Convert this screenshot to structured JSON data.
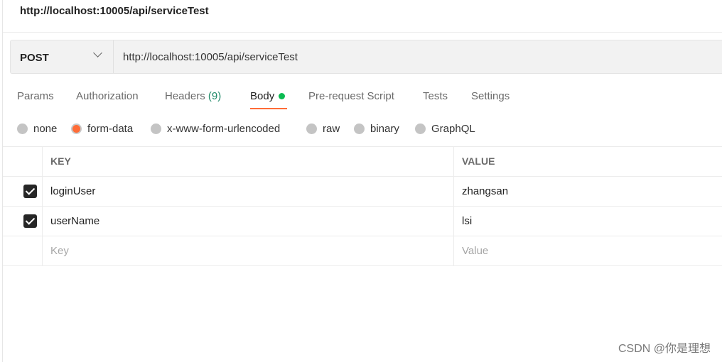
{
  "title": "http://localhost:10005/api/serviceTest",
  "request": {
    "method": "POST",
    "url": "http://localhost:10005/api/serviceTest"
  },
  "tabs": [
    {
      "label": "Params"
    },
    {
      "label": "Authorization"
    },
    {
      "label": "Headers",
      "count": "(9)"
    },
    {
      "label": "Body",
      "active": true
    },
    {
      "label": "Pre-request Script"
    },
    {
      "label": "Tests"
    },
    {
      "label": "Settings"
    }
  ],
  "body_types": [
    {
      "label": "none"
    },
    {
      "label": "form-data",
      "selected": true
    },
    {
      "label": "x-www-form-urlencoded"
    },
    {
      "label": "raw"
    },
    {
      "label": "binary"
    },
    {
      "label": "GraphQL"
    }
  ],
  "table": {
    "headers": {
      "key": "KEY",
      "value": "VALUE"
    },
    "rows": [
      {
        "key": "loginUser",
        "value": "zhangsan",
        "checked": true
      },
      {
        "key": "userName",
        "value": "lsi",
        "checked": true
      }
    ],
    "placeholder": {
      "key": "Key",
      "value": "Value"
    }
  },
  "watermark": "CSDN @你是理想",
  "colors": {
    "accent": "#ff6c37",
    "body_dot": "#0cbb52"
  }
}
